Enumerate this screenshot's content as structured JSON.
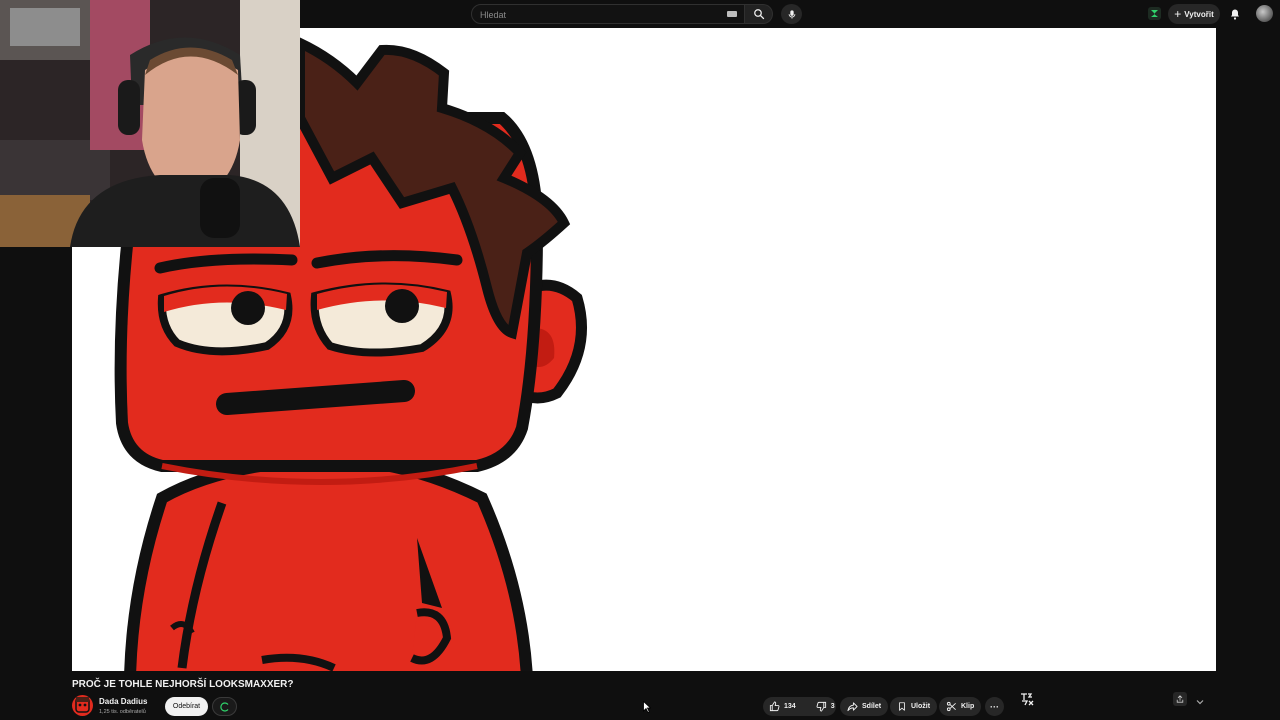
{
  "search": {
    "placeholder": "Hledat"
  },
  "header": {
    "create_label": "Vytvořit"
  },
  "video": {
    "title": "PROČ JE TOHLE NEJHORŠÍ LOOKSMAXXER?"
  },
  "channel": {
    "name": "Dada Dadius",
    "subscribers": "1,25 tis. odběratelů",
    "subscribe_label": "Odebírat"
  },
  "actions": {
    "likes": "134",
    "dislikes": "3",
    "share_label": "Sdílet",
    "save_label": "Uložit",
    "clip_label": "Klip",
    "more_label": "···"
  },
  "colors": {
    "background": "#0f0f0f",
    "character_red": "#e22b1e",
    "character_hair": "#4a2117",
    "outline": "#111111"
  },
  "icons": [
    "search-icon",
    "mic-icon",
    "plus-icon",
    "bell-icon",
    "thumb-up-icon",
    "thumb-down-icon",
    "share-icon",
    "bookmark-icon",
    "scissors-icon",
    "more-icon",
    "chevron-down-icon"
  ]
}
